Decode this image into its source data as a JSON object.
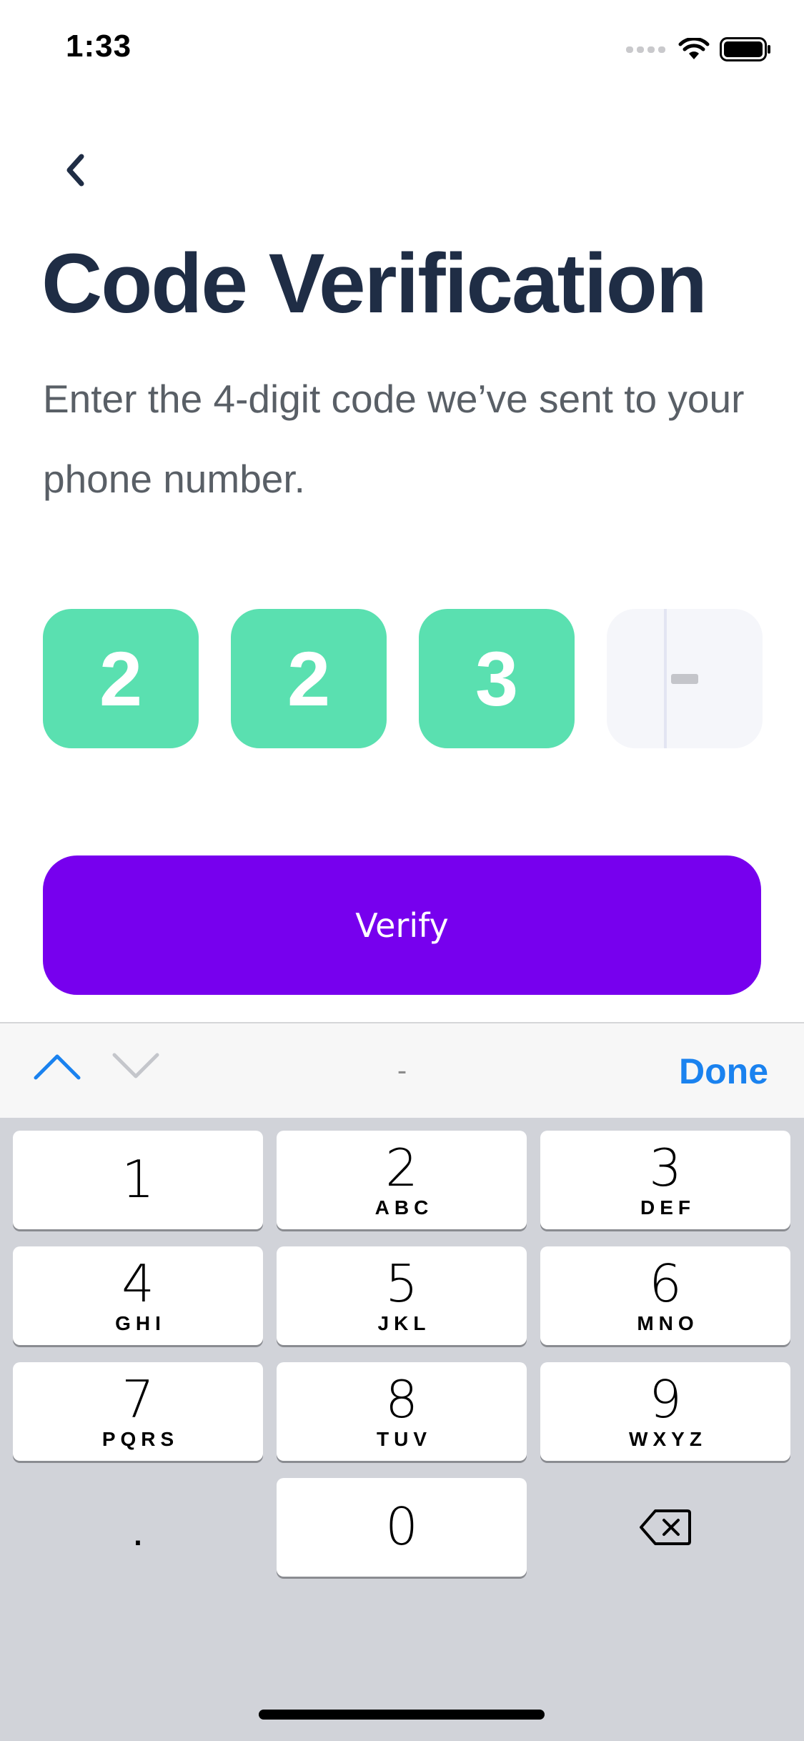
{
  "status_bar": {
    "time": "1:33"
  },
  "header": {
    "title": "Code Verification",
    "subtitle": "Enter the 4-digit code we’ve sent to your phone number."
  },
  "code": {
    "digits": [
      "2",
      "2",
      "3"
    ],
    "empty_placeholder": "-"
  },
  "verify_button": {
    "label": "Verify"
  },
  "keyboard_accessory": {
    "center_text": "-",
    "done_label": "Done"
  },
  "keyboard": {
    "keys": [
      {
        "digit": "1",
        "letters": ""
      },
      {
        "digit": "2",
        "letters": "ABC"
      },
      {
        "digit": "3",
        "letters": "DEF"
      },
      {
        "digit": "4",
        "letters": "GHI"
      },
      {
        "digit": "5",
        "letters": "JKL"
      },
      {
        "digit": "6",
        "letters": "MNO"
      },
      {
        "digit": "7",
        "letters": "PQRS"
      },
      {
        "digit": "8",
        "letters": "TUV"
      },
      {
        "digit": "9",
        "letters": "WXYZ"
      },
      {
        "digit": "0",
        "letters": ""
      }
    ],
    "decimal": "."
  },
  "colors": {
    "title": "#1f2d45",
    "filled_box": "#5ae0b0",
    "empty_box": "#f5f6fa",
    "primary_button": "#7700ee",
    "accent_blue": "#1a82ef",
    "keyboard_bg": "#d1d3d9"
  }
}
